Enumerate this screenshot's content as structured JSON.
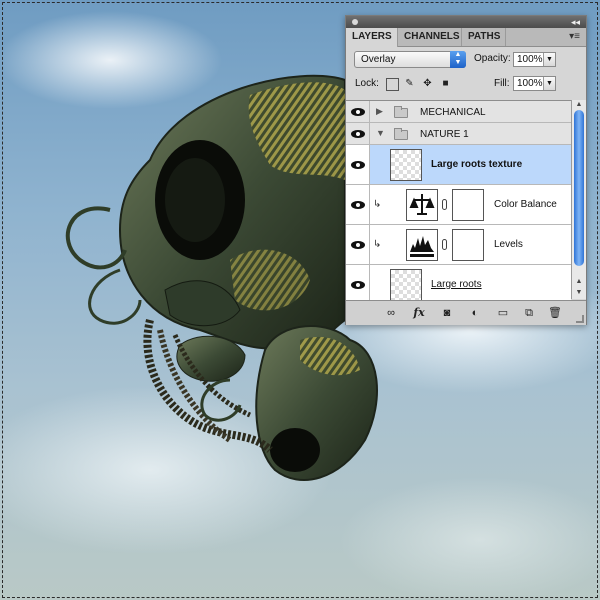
{
  "panel": {
    "tabs": [
      {
        "label": "LAYERS",
        "active": true
      },
      {
        "label": "CHANNELS",
        "active": false
      },
      {
        "label": "PATHS",
        "active": false
      }
    ],
    "blend_mode": "Overlay",
    "opacity_label": "Opacity:",
    "opacity_value": "100%",
    "lock_label": "Lock:",
    "fill_label": "Fill:",
    "fill_value": "100%",
    "layers": [
      {
        "name": "MECHANICAL",
        "type": "group",
        "expanded": false,
        "visible": true
      },
      {
        "name": "NATURE 1",
        "type": "group",
        "expanded": true,
        "visible": true
      },
      {
        "name": "Large roots texture",
        "type": "layer",
        "selected": true,
        "visible": true
      },
      {
        "name": "Color Balance",
        "type": "adjustment",
        "clipped": true,
        "visible": true
      },
      {
        "name": "Levels",
        "type": "adjustment",
        "clipped": true,
        "visible": true
      },
      {
        "name": "Large roots",
        "type": "layer",
        "visible": true
      }
    ],
    "footer_icons": [
      "link-icon",
      "fx-icon",
      "mask-icon",
      "adjustment-icon",
      "new-group-icon",
      "new-layer-icon",
      "trash-icon"
    ]
  },
  "colors": {
    "selected_row": "#bcd8fb",
    "scroll_accent": "#2f74d6"
  }
}
